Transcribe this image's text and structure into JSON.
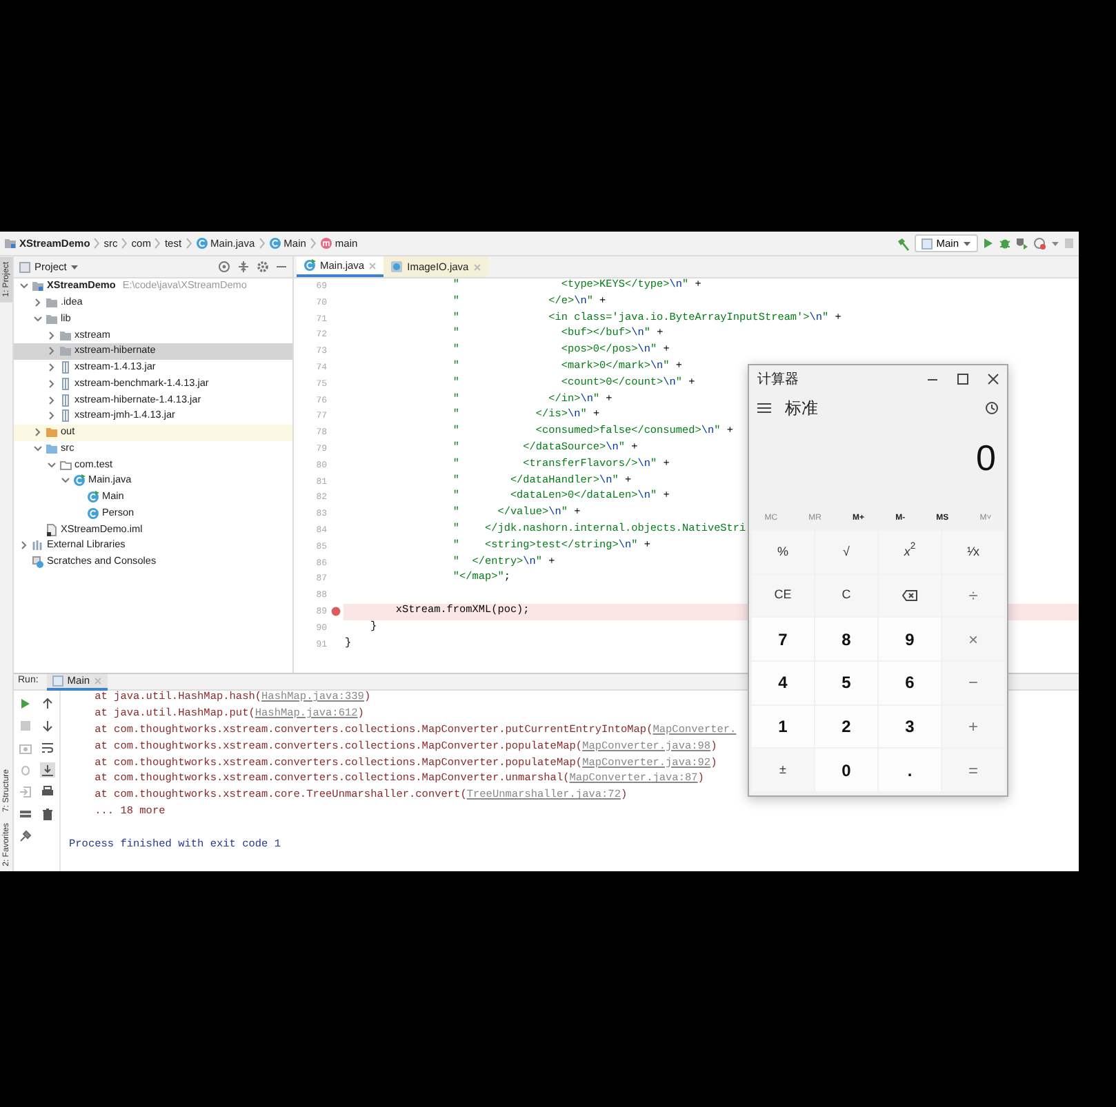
{
  "breadcrumb": [
    {
      "label": "XStreamDemo",
      "kind": "module"
    },
    {
      "label": "src",
      "kind": "plain"
    },
    {
      "label": "com",
      "kind": "plain"
    },
    {
      "label": "test",
      "kind": "plain"
    },
    {
      "label": "Main.java",
      "kind": "class"
    },
    {
      "label": "Main",
      "kind": "class"
    },
    {
      "label": "main",
      "kind": "method"
    }
  ],
  "run_config": "Main",
  "side_tabs": [
    {
      "label": "1: Project",
      "selected": true,
      "kind": "top"
    },
    {
      "label": "7: Structure",
      "selected": false,
      "kind": "bottom"
    },
    {
      "label": "2: Favorites",
      "selected": false,
      "kind": "bottom"
    }
  ],
  "project_panel": {
    "title": "Project",
    "tree": [
      {
        "label": "XStreamDemo",
        "kind": "module",
        "note": "E:\\code\\java\\XStreamDemo",
        "expanded": true,
        "selected": false,
        "highlighted": false,
        "children": [
          {
            "label": ".idea",
            "kind": "folder",
            "expanded": false,
            "selected": false,
            "highlighted": false
          },
          {
            "label": "lib",
            "kind": "folder",
            "expanded": true,
            "selected": false,
            "highlighted": false,
            "children": [
              {
                "label": "xstream",
                "kind": "folder",
                "expanded": false,
                "selected": false,
                "highlighted": false
              },
              {
                "label": "xstream-hibernate",
                "kind": "folder",
                "expanded": false,
                "selected": true,
                "highlighted": false
              },
              {
                "label": "xstream-1.4.13.jar",
                "kind": "jar",
                "expanded": false,
                "selected": false,
                "highlighted": false
              },
              {
                "label": "xstream-benchmark-1.4.13.jar",
                "kind": "jar",
                "expanded": false,
                "selected": false,
                "highlighted": false
              },
              {
                "label": "xstream-hibernate-1.4.13.jar",
                "kind": "jar",
                "expanded": false,
                "selected": false,
                "highlighted": false
              },
              {
                "label": "xstream-jmh-1.4.13.jar",
                "kind": "jar",
                "expanded": false,
                "selected": false,
                "highlighted": false
              }
            ]
          },
          {
            "label": "out",
            "kind": "excluded",
            "expanded": false,
            "selected": false,
            "highlighted": true
          },
          {
            "label": "src",
            "kind": "source",
            "expanded": true,
            "selected": false,
            "highlighted": false,
            "children": [
              {
                "label": "com.test",
                "kind": "package",
                "expanded": true,
                "selected": false,
                "highlighted": false,
                "children": [
                  {
                    "label": "Main.java",
                    "kind": "runclass",
                    "expanded": true,
                    "selected": false,
                    "highlighted": false,
                    "children": [
                      {
                        "label": "Main",
                        "kind": "runclass",
                        "selected": false,
                        "highlighted": false
                      },
                      {
                        "label": "Person",
                        "kind": "class",
                        "selected": false,
                        "highlighted": false
                      }
                    ]
                  }
                ]
              }
            ]
          },
          {
            "label": "XStreamDemo.iml",
            "kind": "iml",
            "selected": false,
            "highlighted": false
          }
        ]
      },
      {
        "label": "External Libraries",
        "kind": "libs",
        "expanded": false,
        "selected": false,
        "highlighted": false
      },
      {
        "label": "Scratches and Consoles",
        "kind": "scratch",
        "selected": false,
        "highlighted": false
      }
    ]
  },
  "editor_tabs": [
    {
      "label": "Main.java",
      "kind": "runclass",
      "selected": true
    },
    {
      "label": "ImageIO.java",
      "kind": "library",
      "selected": false
    }
  ],
  "code_lines": [
    {
      "num": "69",
      "breakpoint": false,
      "parts": [
        {
          "kind": "string",
          "text": "                 \"                <type>KEYS</type>"
        },
        {
          "kind": "escape",
          "text": "\\n"
        },
        {
          "kind": "string",
          "text": "\""
        },
        {
          "kind": "plain",
          "text": " +"
        }
      ]
    },
    {
      "num": "70",
      "breakpoint": false,
      "parts": [
        {
          "kind": "string",
          "text": "                 \"              </e>"
        },
        {
          "kind": "escape",
          "text": "\\n"
        },
        {
          "kind": "string",
          "text": "\""
        },
        {
          "kind": "plain",
          "text": " +"
        }
      ]
    },
    {
      "num": "71",
      "breakpoint": false,
      "parts": [
        {
          "kind": "string",
          "text": "                 \"              <in class='java.io.ByteArrayInputStream'>"
        },
        {
          "kind": "escape",
          "text": "\\n"
        },
        {
          "kind": "string",
          "text": "\""
        },
        {
          "kind": "plain",
          "text": " +"
        }
      ]
    },
    {
      "num": "72",
      "breakpoint": false,
      "parts": [
        {
          "kind": "string",
          "text": "                 \"                <buf></buf>"
        },
        {
          "kind": "escape",
          "text": "\\n"
        },
        {
          "kind": "string",
          "text": "\""
        },
        {
          "kind": "plain",
          "text": " +"
        }
      ]
    },
    {
      "num": "73",
      "breakpoint": false,
      "parts": [
        {
          "kind": "string",
          "text": "                 \"                <pos>0</pos>"
        },
        {
          "kind": "escape",
          "text": "\\n"
        },
        {
          "kind": "string",
          "text": "\""
        },
        {
          "kind": "plain",
          "text": " +"
        }
      ]
    },
    {
      "num": "74",
      "breakpoint": false,
      "parts": [
        {
          "kind": "string",
          "text": "                 \"                <mark>0</mark>"
        },
        {
          "kind": "escape",
          "text": "\\n"
        },
        {
          "kind": "string",
          "text": "\""
        },
        {
          "kind": "plain",
          "text": " +"
        }
      ]
    },
    {
      "num": "75",
      "breakpoint": false,
      "parts": [
        {
          "kind": "string",
          "text": "                 \"                <count>0</count>"
        },
        {
          "kind": "escape",
          "text": "\\n"
        },
        {
          "kind": "string",
          "text": "\""
        },
        {
          "kind": "plain",
          "text": " +"
        }
      ]
    },
    {
      "num": "76",
      "breakpoint": false,
      "parts": [
        {
          "kind": "string",
          "text": "                 \"              </in>"
        },
        {
          "kind": "escape",
          "text": "\\n"
        },
        {
          "kind": "string",
          "text": "\""
        },
        {
          "kind": "plain",
          "text": " +"
        }
      ]
    },
    {
      "num": "77",
      "breakpoint": false,
      "parts": [
        {
          "kind": "string",
          "text": "                 \"            </is>"
        },
        {
          "kind": "escape",
          "text": "\\n"
        },
        {
          "kind": "string",
          "text": "\""
        },
        {
          "kind": "plain",
          "text": " +"
        }
      ]
    },
    {
      "num": "78",
      "breakpoint": false,
      "parts": [
        {
          "kind": "string",
          "text": "                 \"            <consumed>false</consumed>"
        },
        {
          "kind": "escape",
          "text": "\\n"
        },
        {
          "kind": "string",
          "text": "\""
        },
        {
          "kind": "plain",
          "text": " +"
        }
      ]
    },
    {
      "num": "79",
      "breakpoint": false,
      "parts": [
        {
          "kind": "string",
          "text": "                 \"          </dataSource>"
        },
        {
          "kind": "escape",
          "text": "\\n"
        },
        {
          "kind": "string",
          "text": "\""
        },
        {
          "kind": "plain",
          "text": " +"
        }
      ]
    },
    {
      "num": "80",
      "breakpoint": false,
      "parts": [
        {
          "kind": "string",
          "text": "                 \"          <transferFlavors/>"
        },
        {
          "kind": "escape",
          "text": "\\n"
        },
        {
          "kind": "string",
          "text": "\""
        },
        {
          "kind": "plain",
          "text": " +"
        }
      ]
    },
    {
      "num": "81",
      "breakpoint": false,
      "parts": [
        {
          "kind": "string",
          "text": "                 \"        </dataHandler>"
        },
        {
          "kind": "escape",
          "text": "\\n"
        },
        {
          "kind": "string",
          "text": "\""
        },
        {
          "kind": "plain",
          "text": " +"
        }
      ]
    },
    {
      "num": "82",
      "breakpoint": false,
      "parts": [
        {
          "kind": "string",
          "text": "                 \"        <dataLen>0</dataLen>"
        },
        {
          "kind": "escape",
          "text": "\\n"
        },
        {
          "kind": "string",
          "text": "\""
        },
        {
          "kind": "plain",
          "text": " +"
        }
      ]
    },
    {
      "num": "83",
      "breakpoint": false,
      "parts": [
        {
          "kind": "string",
          "text": "                 \"      </value>"
        },
        {
          "kind": "escape",
          "text": "\\n"
        },
        {
          "kind": "string",
          "text": "\""
        },
        {
          "kind": "plain",
          "text": " +"
        }
      ]
    },
    {
      "num": "84",
      "breakpoint": false,
      "parts": [
        {
          "kind": "string",
          "text": "                 \"    </jdk.nashorn.internal.objects.NativeStri"
        }
      ]
    },
    {
      "num": "85",
      "breakpoint": false,
      "parts": [
        {
          "kind": "string",
          "text": "                 \"    <string>test</string>"
        },
        {
          "kind": "escape",
          "text": "\\n"
        },
        {
          "kind": "string",
          "text": "\""
        },
        {
          "kind": "plain",
          "text": " +"
        }
      ]
    },
    {
      "num": "86",
      "breakpoint": false,
      "parts": [
        {
          "kind": "string",
          "text": "                 \"  </entry>"
        },
        {
          "kind": "escape",
          "text": "\\n"
        },
        {
          "kind": "string",
          "text": "\""
        },
        {
          "kind": "plain",
          "text": " +"
        }
      ]
    },
    {
      "num": "87",
      "breakpoint": false,
      "parts": [
        {
          "kind": "string",
          "text": "                 \"</map>\""
        },
        {
          "kind": "plain",
          "text": ";"
        }
      ]
    },
    {
      "num": "88",
      "breakpoint": false
    },
    {
      "num": "89",
      "breakpoint": true,
      "parts": [
        {
          "kind": "plain",
          "text": "        xStream.fromXML(poc);"
        }
      ]
    },
    {
      "num": "90",
      "breakpoint": false,
      "parts": [
        {
          "kind": "plain",
          "text": "    }"
        }
      ]
    },
    {
      "num": "91",
      "breakpoint": false,
      "parts": [
        {
          "kind": "plain",
          "text": "}"
        }
      ]
    }
  ],
  "run_panel": {
    "label": "Run:",
    "tabs": [
      {
        "label": "Main",
        "selected": true
      }
    ],
    "console": [
      {
        "parts": [
          {
            "kind": "trace",
            "text": "    at java.util.HashMap.hash("
          },
          {
            "kind": "link",
            "text": "HashMap.java:339"
          },
          {
            "kind": "trace",
            "text": ")"
          }
        ]
      },
      {
        "parts": [
          {
            "kind": "trace",
            "text": "    at java.util.HashMap.put("
          },
          {
            "kind": "link",
            "text": "HashMap.java:612"
          },
          {
            "kind": "trace",
            "text": ")"
          }
        ]
      },
      {
        "parts": [
          {
            "kind": "trace",
            "text": "    at com.thoughtworks.xstream.converters.collections.MapConverter.putCurrentEntryIntoMap("
          },
          {
            "kind": "link",
            "text": "MapConverter."
          }
        ]
      },
      {
        "parts": [
          {
            "kind": "trace",
            "text": "    at com.thoughtworks.xstream.converters.collections.MapConverter.populateMap("
          },
          {
            "kind": "link",
            "text": "MapConverter.java:98"
          },
          {
            "kind": "trace",
            "text": ")"
          }
        ]
      },
      {
        "parts": [
          {
            "kind": "trace",
            "text": "    at com.thoughtworks.xstream.converters.collections.MapConverter.populateMap("
          },
          {
            "kind": "link",
            "text": "MapConverter.java:92"
          },
          {
            "kind": "trace",
            "text": ")"
          }
        ]
      },
      {
        "parts": [
          {
            "kind": "trace",
            "text": "    at com.thoughtworks.xstream.converters.collections.MapConverter.unmarshal("
          },
          {
            "kind": "link",
            "text": "MapConverter.java:87"
          },
          {
            "kind": "trace",
            "text": ")"
          }
        ]
      },
      {
        "parts": [
          {
            "kind": "trace",
            "text": "    at com.thoughtworks.xstream.core.TreeUnmarshaller.convert("
          },
          {
            "kind": "link",
            "text": "TreeUnmarshaller.java:72"
          },
          {
            "kind": "trace",
            "text": ")"
          }
        ]
      },
      {
        "parts": [
          {
            "kind": "trace",
            "text": "    ... 18 more"
          }
        ]
      },
      {
        "parts": [
          {
            "kind": "info",
            "text": "Process finished with exit code 1"
          }
        ]
      }
    ]
  },
  "calculator": {
    "title": "计算器",
    "mode": "标准",
    "display": "0",
    "memory": [
      {
        "label": "MC",
        "disabled": true
      },
      {
        "label": "MR",
        "disabled": true
      },
      {
        "label": "M+",
        "disabled": false
      },
      {
        "label": "M-",
        "disabled": false
      },
      {
        "label": "MS",
        "disabled": false
      },
      {
        "label": "M˅",
        "disabled": true
      }
    ],
    "keys": [
      {
        "label": "%",
        "kind": "func"
      },
      {
        "label": "√",
        "kind": "func"
      },
      {
        "label": "*x*$^{2}$",
        "kind": "func"
      },
      {
        "label": "¹⁄x",
        "kind": "func"
      },
      {
        "label": "CE",
        "kind": "func"
      },
      {
        "label": "C",
        "kind": "func"
      },
      {
        "kind": "backspace"
      },
      {
        "label": "÷",
        "kind": "op"
      },
      {
        "label": "7",
        "kind": "digit"
      },
      {
        "label": "8",
        "kind": "digit"
      },
      {
        "label": "9",
        "kind": "digit"
      },
      {
        "label": "×",
        "kind": "op"
      },
      {
        "label": "4",
        "kind": "digit"
      },
      {
        "label": "5",
        "kind": "digit"
      },
      {
        "label": "6",
        "kind": "digit"
      },
      {
        "label": "−",
        "kind": "op"
      },
      {
        "label": "1",
        "kind": "digit"
      },
      {
        "label": "2",
        "kind": "digit"
      },
      {
        "label": "3",
        "kind": "digit"
      },
      {
        "label": "+",
        "kind": "op"
      },
      {
        "label": "±",
        "kind": "func"
      },
      {
        "label": "0",
        "kind": "digit"
      },
      {
        "label": ".",
        "kind": "digit"
      },
      {
        "label": "=",
        "kind": "op"
      }
    ]
  }
}
